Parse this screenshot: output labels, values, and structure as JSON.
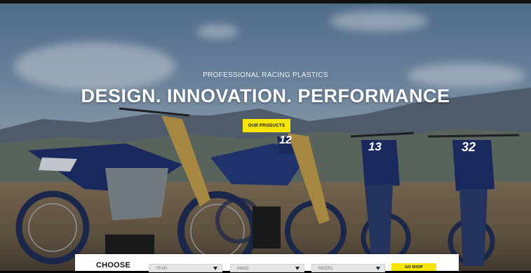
{
  "hero": {
    "tagline": "PROFESSIONAL RACING PLASTICS",
    "headline": "DESIGN. INNOVATION. PERFORMANCE",
    "cta_label": "OUR PRODUCTS",
    "bike_numbers": [
      "12",
      "13",
      "32"
    ]
  },
  "finder": {
    "title": "CHOOSE",
    "year_placeholder": "YEAR",
    "make_placeholder": "MAKE",
    "model_placeholder": "MODEL",
    "shop_label": "GO SHOP"
  },
  "colors": {
    "accent": "#f5e50a",
    "bike_blue": "#1d2d6b",
    "bike_dark": "#0e1632"
  },
  "icons": {
    "dropdown": "chevron-down-icon"
  }
}
